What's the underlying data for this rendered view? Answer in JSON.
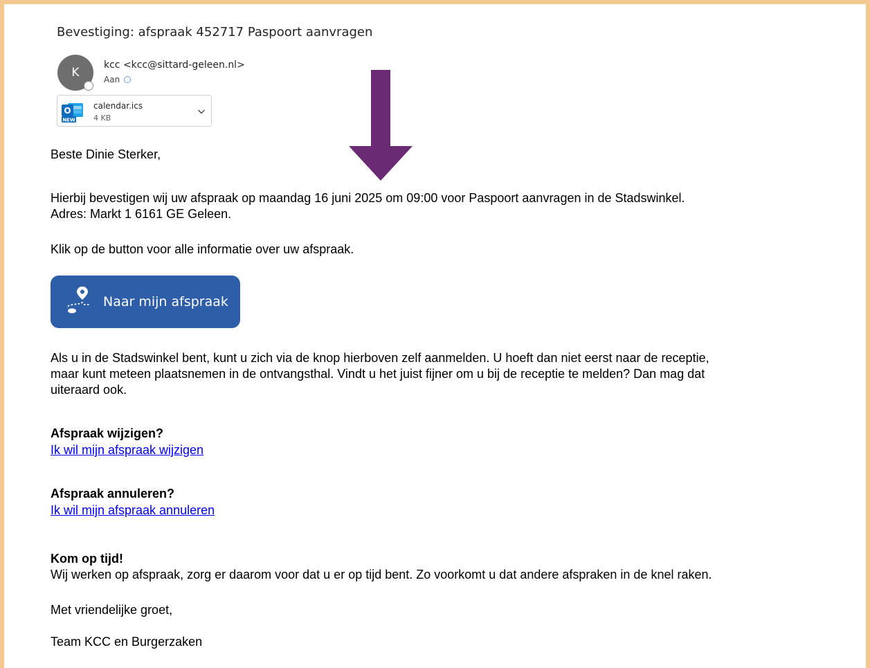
{
  "email": {
    "subject": "Bevestiging: afspraak 452717 Paspoort aanvragen",
    "sender": {
      "initial": "K",
      "display": "kcc <kcc@sittard-geleen.nl>",
      "to_label": "Aan"
    },
    "attachment": {
      "filename": "calendar.ics",
      "size": "4 KB",
      "icon": "outlook-new-icon",
      "icon_letter": "O",
      "icon_badge": "NEW"
    }
  },
  "body": {
    "greeting": "Beste Dinie Sterker,",
    "confirmation": "Hierbij bevestigen wij uw afspraak op maandag 16 juni 2025 om 09:00 voor Paspoort aanvragen in de Stadswinkel.",
    "address": "Adres:  Markt 1 6161 GE Geleen.",
    "button_intro": "Klik op de button voor alle informatie over uw afspraak.",
    "button_label": "Naar mijn afspraak",
    "checkin_line1": "Als u in de Stadswinkel bent, kunt u zich via de knop hierboven zelf aanmelden. U hoeft dan niet eerst naar de receptie,",
    "checkin_line2": "maar kunt meteen plaatsnemen in de ontvangsthal. Vindt u het juist fijner om u bij de receptie te melden? Dan mag dat",
    "checkin_line3": "uiteraard ook.",
    "change_heading": "Afspraak wijzigen?",
    "change_link": "Ik wil mijn afspraak wijzigen",
    "cancel_heading": "Afspraak annuleren?",
    "cancel_link": "Ik wil mijn afspraak annuleren",
    "ontime_heading": "Kom op tijd!",
    "ontime_text": "Wij werken op afspraak, zorg er daarom voor dat u er op tijd bent. Zo voorkomt u dat andere afspraken in de knel raken.",
    "closing": "Met vriendelijke groet,",
    "signature": "Team KCC en Burgerzaken"
  },
  "colors": {
    "frame": "#F3C98F",
    "arrow": "#6B2A74",
    "button": "#2E5EA8",
    "link": "#0000EE"
  }
}
